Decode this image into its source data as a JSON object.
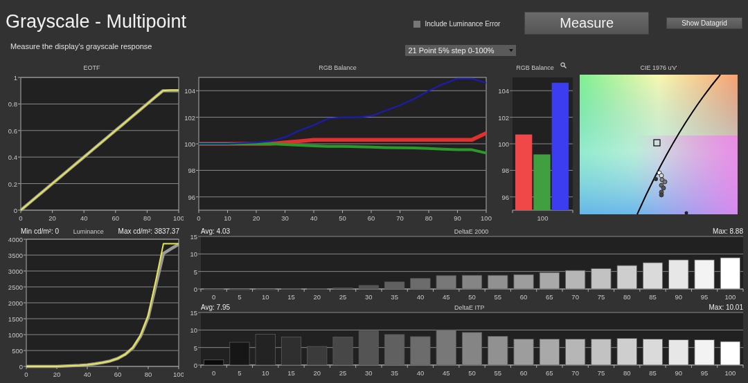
{
  "header": {
    "title": "Grayscale - Multipoint",
    "subtitle": "Measure the display's grayscale response",
    "luminance_error": {
      "label": "Include Luminance Error",
      "checked": false
    },
    "measure_button": "Measure",
    "datagrid_button": "Show Datagrid",
    "pattern_select": {
      "value": "21 Point 5% step 0-100%"
    }
  },
  "eotf": {
    "chart_data": {
      "type": "line",
      "title": "EOTF",
      "grid": true,
      "x": [
        0,
        5,
        10,
        15,
        20,
        25,
        30,
        35,
        40,
        45,
        50,
        55,
        60,
        65,
        70,
        75,
        80,
        85,
        90,
        95,
        100
      ],
      "xlim": [
        0,
        100
      ],
      "ylim": [
        0,
        1
      ],
      "xticks": [
        0,
        20,
        40,
        60,
        80,
        100
      ],
      "yticks": [
        0,
        0.2,
        0.4,
        0.6,
        0.8,
        1
      ],
      "series": [
        {
          "color": "#9a9a9a",
          "values": [
            0,
            0.05,
            0.1,
            0.15,
            0.2,
            0.25,
            0.3,
            0.35,
            0.4,
            0.45,
            0.5,
            0.55,
            0.6,
            0.65,
            0.7,
            0.75,
            0.8,
            0.85,
            0.9,
            0.9,
            0.9
          ]
        },
        {
          "color": "#e8e84a",
          "values": [
            0,
            0.05,
            0.1,
            0.15,
            0.2,
            0.25,
            0.3,
            0.35,
            0.4,
            0.45,
            0.5,
            0.55,
            0.6,
            0.65,
            0.7,
            0.75,
            0.8,
            0.85,
            0.9,
            0.905,
            0.905
          ]
        }
      ]
    }
  },
  "rgb_balance_line": {
    "chart_data": {
      "type": "line",
      "title": "RGB Balance",
      "grid": true,
      "x": [
        0,
        5,
        10,
        15,
        20,
        25,
        30,
        35,
        40,
        45,
        50,
        55,
        60,
        65,
        70,
        75,
        80,
        85,
        90,
        95,
        100
      ],
      "xlim": [
        0,
        100
      ],
      "ylim": [
        95,
        105
      ],
      "xticks": [
        0,
        10,
        20,
        30,
        40,
        50,
        60,
        70,
        80,
        90,
        100
      ],
      "yticks": [
        96,
        98,
        100,
        102,
        104
      ],
      "series": [
        {
          "color": "#e03030",
          "values": [
            100,
            100,
            100,
            100,
            100,
            100,
            100.1,
            100.2,
            100.3,
            100.3,
            100.3,
            100.3,
            100.3,
            100.3,
            100.3,
            100.3,
            100.3,
            100.3,
            100.3,
            100.3,
            100.8
          ]
        },
        {
          "color": "#2a9a2a",
          "values": [
            100,
            100,
            100,
            100,
            100,
            100,
            99.95,
            99.9,
            99.85,
            99.8,
            99.8,
            99.78,
            99.75,
            99.72,
            99.7,
            99.68,
            99.65,
            99.6,
            99.55,
            99.55,
            99.3
          ]
        },
        {
          "color": "#1c1cb0",
          "values": [
            100,
            100,
            100,
            100.05,
            100.1,
            100.2,
            100.5,
            101,
            101.4,
            101.9,
            102,
            102,
            102.1,
            102.5,
            102.9,
            103.4,
            104,
            104.5,
            104.9,
            104.9,
            104.6
          ]
        }
      ]
    }
  },
  "rgb_balance_bar": {
    "chart_data": {
      "type": "bar",
      "title": "RGB Balance",
      "grid": true,
      "categories": [
        "100"
      ],
      "ylim": [
        95,
        105
      ],
      "yticks": [
        96,
        98,
        100,
        102,
        104
      ],
      "series": [
        {
          "color": "#f04848",
          "values": [
            100.7
          ]
        },
        {
          "color": "#40a040",
          "values": [
            99.2
          ]
        },
        {
          "color": "#3c3cf0",
          "values": [
            104.6
          ]
        }
      ]
    }
  },
  "cie": {
    "title": "CIE 1976 u'v'"
  },
  "luminance": {
    "min": "Min cd/m²: 0",
    "max": "Max cd/m²: 3837.37",
    "chart_data": {
      "type": "line",
      "title": "Luminance",
      "grid": true,
      "x": [
        0,
        5,
        10,
        15,
        20,
        25,
        30,
        35,
        40,
        45,
        50,
        55,
        60,
        65,
        70,
        75,
        80,
        85,
        90,
        95,
        100
      ],
      "xlim": [
        0,
        100
      ],
      "ylim": [
        0,
        4000
      ],
      "xticks": [
        0,
        20,
        40,
        60,
        80,
        100
      ],
      "yticks": [
        0,
        500,
        1000,
        1500,
        2000,
        2500,
        3000,
        3500,
        4000
      ],
      "series": [
        {
          "color": "#9a9a9a",
          "values": [
            0,
            0,
            0,
            0,
            0,
            10,
            20,
            30,
            50,
            80,
            120,
            170,
            250,
            380,
            580,
            950,
            1550,
            2550,
            3550,
            3700,
            3840
          ]
        },
        {
          "color": "#e8e84a",
          "values": [
            0,
            0,
            0,
            0,
            0,
            10,
            20,
            30,
            50,
            80,
            120,
            170,
            250,
            380,
            600,
            980,
            1600,
            2700,
            3860,
            3860,
            3860
          ]
        }
      ]
    }
  },
  "deltae_2000": {
    "avg": "Avg: 4.03",
    "max": "Max: 8.88",
    "chart_data": {
      "type": "bar",
      "title": "DeltaE 2000",
      "categories": [
        "0",
        "5",
        "10",
        "15",
        "20",
        "25",
        "30",
        "35",
        "40",
        "45",
        "50",
        "55",
        "60",
        "65",
        "70",
        "75",
        "80",
        "85",
        "90",
        "95",
        "100"
      ],
      "ylim": [
        0,
        15
      ],
      "yticks": [
        0,
        5,
        10,
        15
      ],
      "values": [
        0,
        0,
        0,
        0.1,
        0.1,
        0.3,
        1,
        2,
        3,
        3.8,
        3.9,
        3.9,
        4.1,
        4.7,
        5.3,
        5.8,
        6.7,
        7.5,
        8.3,
        8.3,
        8.9
      ],
      "grid": true
    }
  },
  "deltae_itp": {
    "avg": "Avg: 7.95",
    "max": "Max: 10.01",
    "chart_data": {
      "type": "bar",
      "title": "DeltaE ITP",
      "categories": [
        "0",
        "5",
        "10",
        "15",
        "20",
        "25",
        "30",
        "35",
        "40",
        "45",
        "50",
        "55",
        "60",
        "65",
        "70",
        "75",
        "80",
        "85",
        "90",
        "95",
        "100"
      ],
      "ylim": [
        0,
        15
      ],
      "yticks": [
        0,
        5,
        10,
        15
      ],
      "values": [
        1.5,
        6.5,
        8.8,
        8,
        5.3,
        8,
        9.7,
        8.7,
        8.1,
        10,
        9.3,
        8.2,
        7.4,
        7.4,
        7.4,
        7.4,
        7.6,
        7.4,
        7.2,
        7.2,
        6.7
      ],
      "grid": true
    }
  }
}
